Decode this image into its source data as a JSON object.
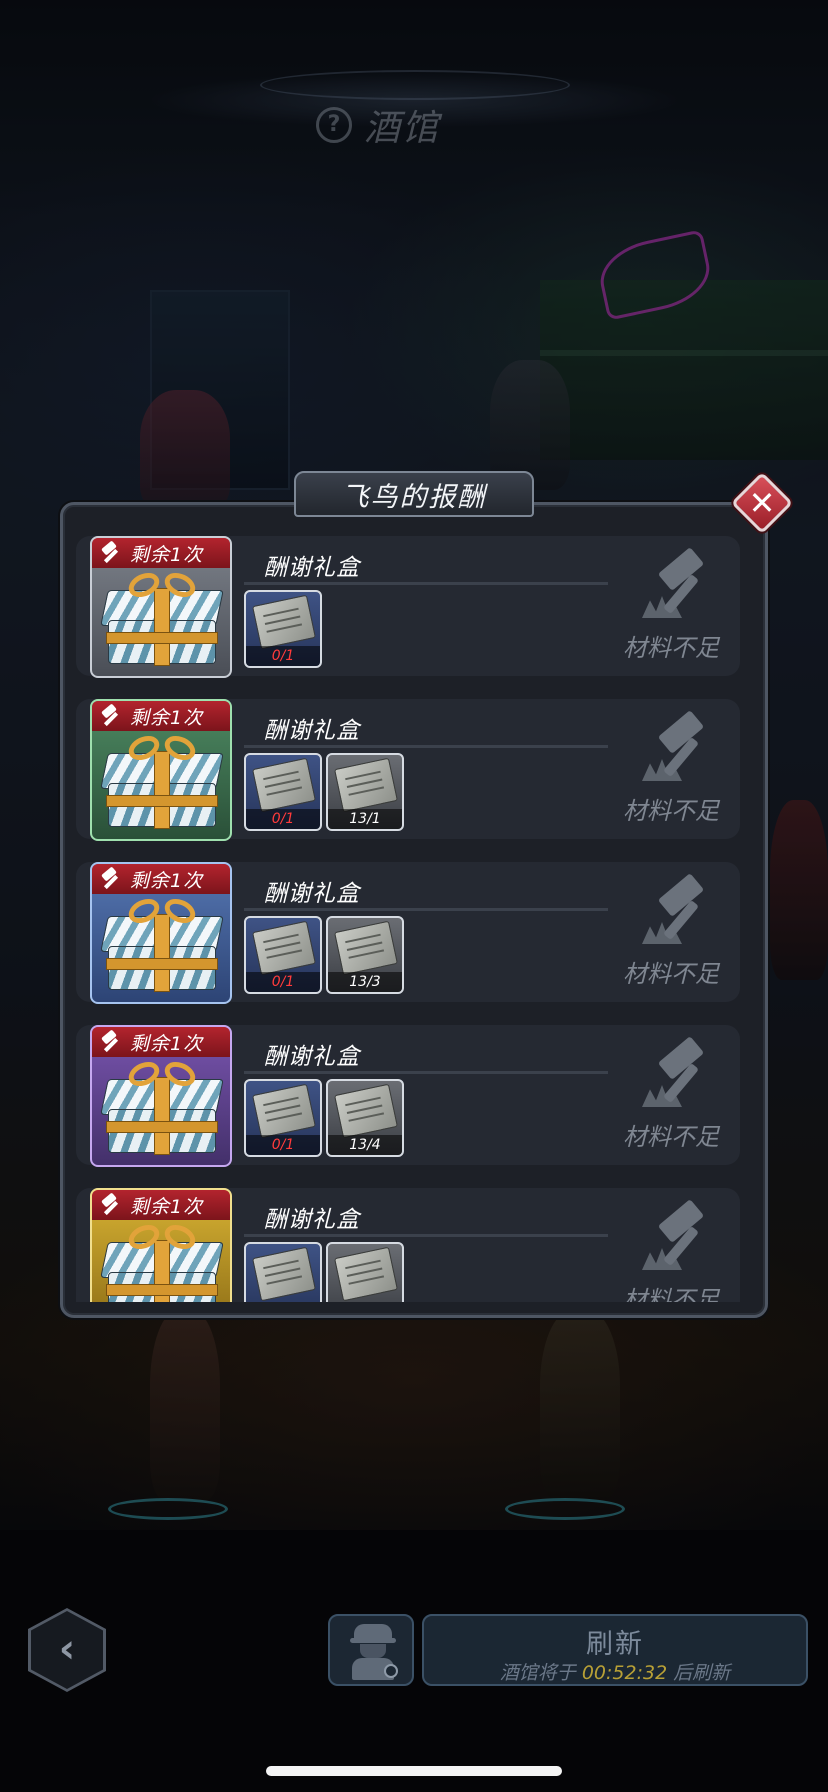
{
  "header": {
    "title": "酒馆",
    "help_icon_glyph": "?"
  },
  "modal": {
    "title": "飞鸟的报酬",
    "close_glyph": "✕"
  },
  "rewards": [
    {
      "badge": "剩余1次",
      "name": "酬谢礼盒",
      "tier": "grey",
      "materials": [
        {
          "count": "0/1",
          "status": "insufficient"
        }
      ],
      "action": "材料不足"
    },
    {
      "badge": "剩余1次",
      "name": "酬谢礼盒",
      "tier": "green",
      "materials": [
        {
          "count": "0/1",
          "status": "insufficient"
        },
        {
          "count": "13/1",
          "status": "ok"
        }
      ],
      "action": "材料不足"
    },
    {
      "badge": "剩余1次",
      "name": "酬谢礼盒",
      "tier": "blue",
      "materials": [
        {
          "count": "0/1",
          "status": "insufficient"
        },
        {
          "count": "13/3",
          "status": "ok"
        }
      ],
      "action": "材料不足"
    },
    {
      "badge": "剩余1次",
      "name": "酬谢礼盒",
      "tier": "purple",
      "materials": [
        {
          "count": "0/1",
          "status": "insufficient"
        },
        {
          "count": "13/4",
          "status": "ok"
        }
      ],
      "action": "材料不足"
    },
    {
      "badge": "剩余1次",
      "name": "酬谢礼盒",
      "tier": "gold",
      "materials": [
        {
          "count": "",
          "status": "insufficient"
        },
        {
          "count": "",
          "status": "ok"
        }
      ],
      "action": "材料不足"
    }
  ],
  "bottom_bar": {
    "back_glyph": "‹",
    "refresh_label": "刷新",
    "refresh_prefix": "酒馆将于",
    "refresh_time": "00:52:32",
    "refresh_suffix": "后刷新"
  },
  "icons": {
    "help": "help-icon",
    "close": "close-icon",
    "remain": "hammer-icon",
    "gift": "gift-box-icon",
    "material": "map-fragment-icon",
    "craft": "craft-hammer-icon",
    "back": "chevron-left-icon",
    "agent": "spy-agent-icon"
  },
  "colors": {
    "insufficient": "#ff3b3b",
    "timer": "#b8a036",
    "badge_red": "#b3242e",
    "close_red": "#d9505a"
  }
}
